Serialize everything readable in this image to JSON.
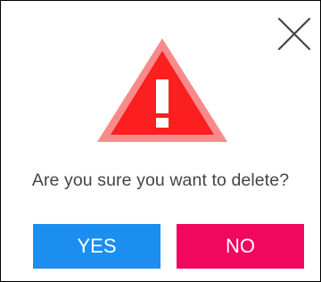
{
  "dialog": {
    "message": "Are you sure you want to delete?",
    "icon": "warning-triangle-icon",
    "close_icon": "close-icon",
    "yes_label": "YES",
    "no_label": "NO"
  },
  "colors": {
    "warning_outer": "#f78b8b",
    "warning_inner": "#fb1f1f",
    "yes_button": "#1c8ef0",
    "no_button": "#f0085f",
    "text": "#444444"
  }
}
